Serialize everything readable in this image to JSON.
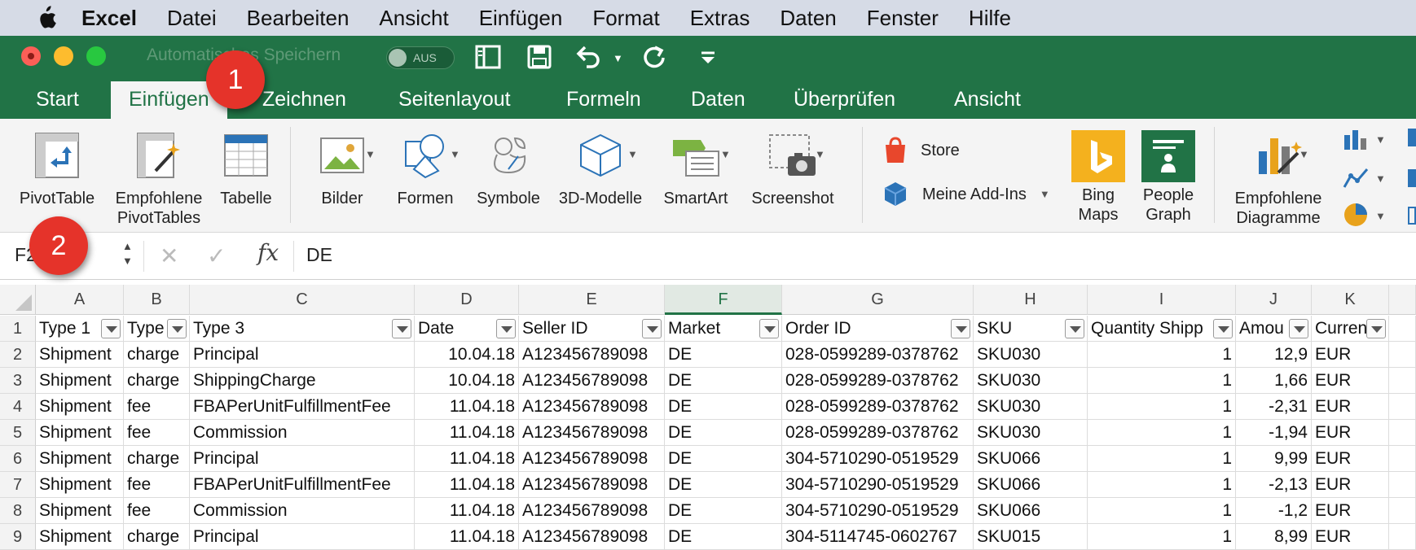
{
  "menubar": {
    "app": "Excel",
    "items": [
      "Datei",
      "Bearbeiten",
      "Ansicht",
      "Einfügen",
      "Format",
      "Extras",
      "Daten",
      "Fenster",
      "Hilfe"
    ]
  },
  "titlebar": {
    "autosave_label": "Automatisches Speichern",
    "autosave_state": "AUS"
  },
  "tabs": [
    "Start",
    "Einfügen",
    "Zeichnen",
    "Seitenlayout",
    "Formeln",
    "Daten",
    "Überprüfen",
    "Ansicht"
  ],
  "ribbon": {
    "pivottable": "PivotTable",
    "empfohlene_pivot_1": "Empfohlene",
    "empfohlene_pivot_2": "PivotTables",
    "tabelle": "Tabelle",
    "bilder": "Bilder",
    "formen": "Formen",
    "symbole": "Symbole",
    "modelle": "3D-Modelle",
    "smartart": "SmartArt",
    "screenshot": "Screenshot",
    "store": "Store",
    "addins": "Meine Add-Ins",
    "bing_1": "Bing",
    "bing_2": "Maps",
    "people_1": "People",
    "people_2": "Graph",
    "diagramme_1": "Empfohlene",
    "diagramme_2": "Diagramme"
  },
  "formula_bar": {
    "namebox": "F2",
    "fx": "fx",
    "value": "DE"
  },
  "callouts": [
    "1",
    "2"
  ],
  "columns": [
    "A",
    "B",
    "C",
    "D",
    "E",
    "F",
    "G",
    "H",
    "I",
    "J",
    "K"
  ],
  "selected_column": "F",
  "rows": [
    [
      "Type 1",
      "Type",
      "Type 3",
      "Date",
      "Seller ID",
      "Market",
      "Order ID",
      "SKU",
      "Quantity Shipp",
      "Amou",
      "Curren"
    ],
    [
      "Shipment",
      "charge",
      "Principal",
      "10.04.18",
      "A123456789098",
      "DE",
      "028-0599289-0378762",
      "SKU030",
      "1",
      "12,9",
      "EUR"
    ],
    [
      "Shipment",
      "charge",
      "ShippingCharge",
      "10.04.18",
      "A123456789098",
      "DE",
      "028-0599289-0378762",
      "SKU030",
      "1",
      "1,66",
      "EUR"
    ],
    [
      "Shipment",
      "fee",
      "FBAPerUnitFulfillmentFee",
      "11.04.18",
      "A123456789098",
      "DE",
      "028-0599289-0378762",
      "SKU030",
      "1",
      "-2,31",
      "EUR"
    ],
    [
      "Shipment",
      "fee",
      "Commission",
      "11.04.18",
      "A123456789098",
      "DE",
      "028-0599289-0378762",
      "SKU030",
      "1",
      "-1,94",
      "EUR"
    ],
    [
      "Shipment",
      "charge",
      "Principal",
      "11.04.18",
      "A123456789098",
      "DE",
      "304-5710290-0519529",
      "SKU066",
      "1",
      "9,99",
      "EUR"
    ],
    [
      "Shipment",
      "fee",
      "FBAPerUnitFulfillmentFee",
      "11.04.18",
      "A123456789098",
      "DE",
      "304-5710290-0519529",
      "SKU066",
      "1",
      "-2,13",
      "EUR"
    ],
    [
      "Shipment",
      "fee",
      "Commission",
      "11.04.18",
      "A123456789098",
      "DE",
      "304-5710290-0519529",
      "SKU066",
      "1",
      "-1,2",
      "EUR"
    ],
    [
      "Shipment",
      "charge",
      "Principal",
      "11.04.18",
      "A123456789098",
      "DE",
      "304-5114745-0602767",
      "SKU015",
      "1",
      "8,99",
      "EUR"
    ]
  ],
  "row_numbers": [
    "1",
    "2",
    "3",
    "4",
    "5",
    "6",
    "7",
    "8",
    "9"
  ]
}
